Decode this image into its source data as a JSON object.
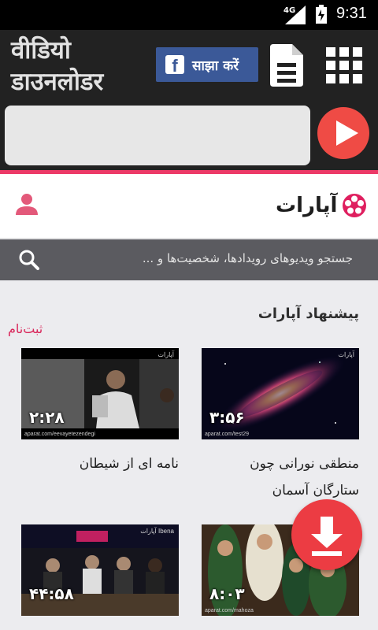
{
  "status_bar": {
    "network": "4G",
    "time": "9:31"
  },
  "app": {
    "title": "वीडियो डाउनलोडर",
    "share_label": "साझा करें",
    "url_input": {
      "value": "",
      "placeholder": ""
    },
    "accent": "#ec3967"
  },
  "site": {
    "logo_text": "آپارات",
    "search_placeholder": "جستجو ویدیوهای رویدادها، شخصیت‌ها و ...",
    "section_title": "پیشنهاد آپارات",
    "signup_label": "ثبت‌نام"
  },
  "videos": [
    {
      "title": "منطقی نورانی چون ستارگان آسمان",
      "duration": "۳:۵۶",
      "source": "aparat.com/test29",
      "watermark": "آپارات"
    },
    {
      "title": "نامه ای از شیطان",
      "duration": "۲:۲۸",
      "source": "aparat.com/eevayetezendegi",
      "watermark": "آپارات"
    },
    {
      "title": "",
      "duration": "۸:۰۳",
      "source": "aparat.com/mahoza",
      "watermark": ""
    },
    {
      "title": "",
      "duration": "۴۴:۵۸",
      "source": "",
      "watermark": "آپارات Ibena"
    }
  ],
  "icons": {
    "document": "document-icon",
    "grid": "grid-menu-icon",
    "play": "play-icon",
    "user": "user-icon",
    "search": "search-icon",
    "download": "download-icon"
  }
}
